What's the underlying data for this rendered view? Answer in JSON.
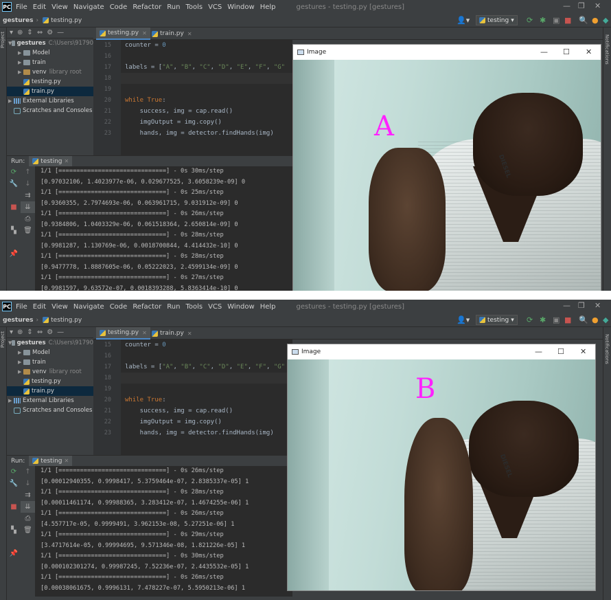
{
  "shots": [
    {
      "menu": {
        "items": [
          "File",
          "Edit",
          "View",
          "Navigate",
          "Code",
          "Refactor",
          "Run",
          "Tools",
          "VCS",
          "Window",
          "Help"
        ],
        "title": "gestures - testing.py [gestures]"
      },
      "nav": {
        "crumb1": "gestures",
        "crumb2": "testing.py",
        "run_config": "testing"
      },
      "tabs": [
        "testing.py",
        "train.py"
      ],
      "tree": {
        "root": "gestures",
        "root_path": "C:\\Users\\91790",
        "items": [
          "Model",
          "train",
          "venv",
          "testing.py",
          "train.py",
          "External Libraries",
          "Scratches and Consoles"
        ],
        "venv_note": "library root"
      },
      "gutter": [
        "15",
        "16",
        "17",
        "18",
        "19",
        "20",
        "21",
        "22",
        "23"
      ],
      "code": [
        "counter = 0",
        "",
        "labels = [\"A\", \"B\", \"C\", \"D\", \"E\", \"F\", \"G\"",
        "",
        "",
        "while True:",
        "    success, img = cap.read()",
        "    imgOutput = img.copy()",
        "    hands, img = detector.findHands(img)"
      ],
      "run": {
        "label": "Run:",
        "tab": "testing"
      },
      "console": [
        "1/1 [==============================] - 0s 30ms/step",
        "[0.97032106, 1.4023977e-06, 0.029677525, 3.6058239e-09] 0",
        "1/1 [==============================] - 0s 25ms/step",
        "[0.9360355, 2.7974693e-06, 0.063961715, 9.031912e-09] 0",
        "1/1 [==============================] - 0s 26ms/step",
        "[0.9384806, 1.0403329e-06, 0.061518364, 2.650814e-09] 0",
        "1/1 [==============================] - 0s 28ms/step",
        "[0.9981287, 1.130769e-06, 0.0018700844, 4.414432e-10] 0",
        "1/1 [==============================] - 0s 28ms/step",
        "[0.9477778, 1.8887605e-06, 0.05222023, 2.4599134e-09] 0",
        "1/1 [==============================] - 0s 27ms/step",
        "[0.9981597, 9.63572e-07, 0.0018393288, 5.8363414e-10] 0"
      ],
      "image": {
        "title": "Image",
        "letter": "A",
        "shirt_text": "DIESEL"
      },
      "strips": {
        "left": "Project",
        "right": "Notifications"
      }
    },
    {
      "menu": {
        "items": [
          "File",
          "Edit",
          "View",
          "Navigate",
          "Code",
          "Refactor",
          "Run",
          "Tools",
          "VCS",
          "Window",
          "Help"
        ],
        "title": "gestures - testing.py [gestures]"
      },
      "nav": {
        "crumb1": "gestures",
        "crumb2": "testing.py",
        "run_config": "testing"
      },
      "tabs": [
        "testing.py",
        "train.py"
      ],
      "tree": {
        "root": "gestures",
        "root_path": "C:\\Users\\91790",
        "items": [
          "Model",
          "train",
          "venv",
          "testing.py",
          "train.py",
          "External Libraries",
          "Scratches and Consoles"
        ],
        "venv_note": "library root"
      },
      "gutter": [
        "15",
        "16",
        "17",
        "18",
        "19",
        "20",
        "21",
        "22",
        "23"
      ],
      "code": [
        "counter = 0",
        "",
        "labels = [\"A\", \"B\", \"C\", \"D\", \"E\", \"F\", \"G\"",
        "",
        "",
        "while True:",
        "    success, img = cap.read()",
        "    imgOutput = img.copy()",
        "    hands, img = detector.findHands(img)"
      ],
      "run": {
        "label": "Run:",
        "tab": "testing"
      },
      "console": [
        "1/1 [==============================] - 0s 26ms/step",
        "[0.00012940355, 0.9998417, 5.3759464e-07, 2.8385337e-05] 1",
        "1/1 [==============================] - 0s 28ms/step",
        "[0.00011461174, 0.99988365, 3.283412e-07, 1.4674255e-06] 1",
        "1/1 [==============================] - 0s 26ms/step",
        "[4.557717e-05, 0.9999491, 3.962153e-08, 5.27251e-06] 1",
        "1/1 [==============================] - 0s 29ms/step",
        "[3.4717614e-05, 0.99994695, 9.571346e-08, 1.821226e-05] 1",
        "1/1 [==============================] - 0s 30ms/step",
        "[0.000102301274, 0.99987245, 7.52236e-07, 2.4435532e-05] 1",
        "1/1 [==============================] - 0s 26ms/step",
        "[0.00038061675, 0.9996131, 7.478227e-07, 5.5950213e-06] 1"
      ],
      "image": {
        "title": "Image",
        "letter": "B",
        "shirt_text": "DIESEL"
      },
      "strips": {
        "left": "Project",
        "right": "Notifications"
      }
    }
  ],
  "colors": {
    "ide_bg": "#3c3f41",
    "editor_bg": "#2b2b2b",
    "accent": "#4a88c7",
    "letter": "#ff22ff"
  },
  "icons": [
    "pycharm-logo-icon",
    "user-icon",
    "run-icon",
    "debug-icon",
    "stop-icon",
    "search-icon",
    "update-icon",
    "folder-icon",
    "python-file-icon",
    "gear-icon",
    "minimize-icon",
    "maximize-icon",
    "close-icon",
    "rerun-icon",
    "wrench-icon",
    "scroll-icon",
    "print-icon",
    "trash-icon"
  ]
}
